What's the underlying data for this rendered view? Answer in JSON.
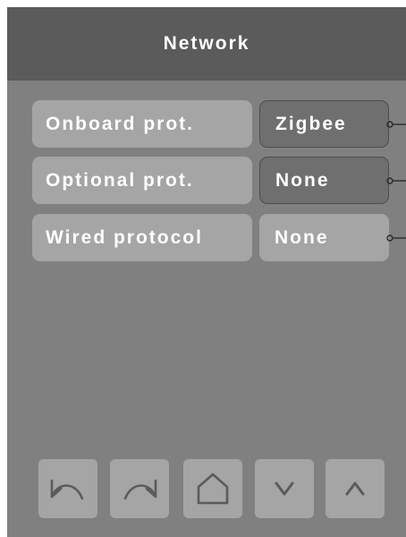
{
  "header": {
    "title": "Network"
  },
  "rows": [
    {
      "label": "Onboard prot.",
      "value": "Zigbee"
    },
    {
      "label": "Optional prot.",
      "value": "None"
    },
    {
      "label": "Wired protocol",
      "value": "None"
    }
  ],
  "footer": {
    "buttons": [
      {
        "icon": "undo-icon"
      },
      {
        "icon": "redo-icon"
      },
      {
        "icon": "home-icon"
      },
      {
        "icon": "chevron-down-icon"
      },
      {
        "icon": "chevron-up-icon"
      }
    ]
  },
  "colors": {
    "screen_bg": "#808080",
    "header_bg": "#5b5b5b",
    "button_bg": "#a5a5a5",
    "value_selected_bg": "#6f6f6f",
    "icon_stroke": "#5b5b5b"
  }
}
